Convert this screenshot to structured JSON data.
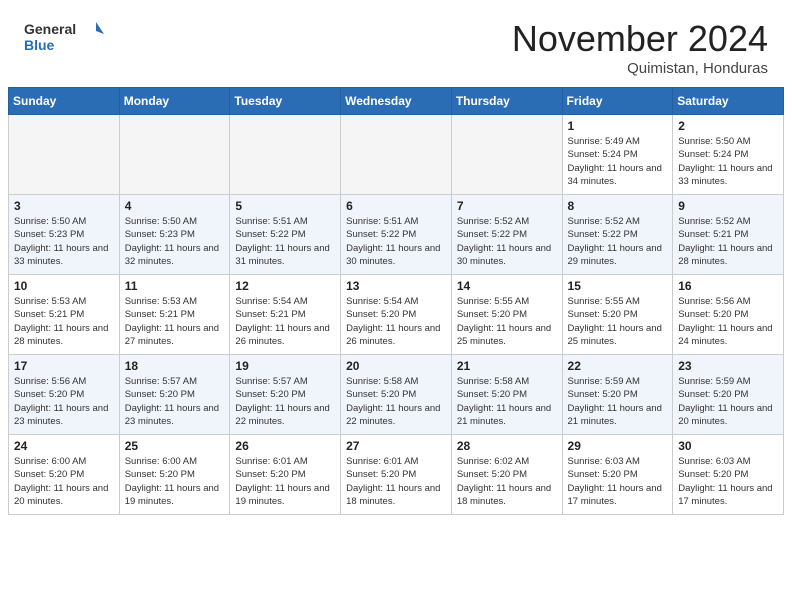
{
  "header": {
    "logo_general": "General",
    "logo_blue": "Blue",
    "month_title": "November 2024",
    "location": "Quimistan, Honduras"
  },
  "weekdays": [
    "Sunday",
    "Monday",
    "Tuesday",
    "Wednesday",
    "Thursday",
    "Friday",
    "Saturday"
  ],
  "weeks": [
    [
      {
        "day": "",
        "info": ""
      },
      {
        "day": "",
        "info": ""
      },
      {
        "day": "",
        "info": ""
      },
      {
        "day": "",
        "info": ""
      },
      {
        "day": "",
        "info": ""
      },
      {
        "day": "1",
        "info": "Sunrise: 5:49 AM\nSunset: 5:24 PM\nDaylight: 11 hours\nand 34 minutes."
      },
      {
        "day": "2",
        "info": "Sunrise: 5:50 AM\nSunset: 5:24 PM\nDaylight: 11 hours\nand 33 minutes."
      }
    ],
    [
      {
        "day": "3",
        "info": "Sunrise: 5:50 AM\nSunset: 5:23 PM\nDaylight: 11 hours\nand 33 minutes."
      },
      {
        "day": "4",
        "info": "Sunrise: 5:50 AM\nSunset: 5:23 PM\nDaylight: 11 hours\nand 32 minutes."
      },
      {
        "day": "5",
        "info": "Sunrise: 5:51 AM\nSunset: 5:22 PM\nDaylight: 11 hours\nand 31 minutes."
      },
      {
        "day": "6",
        "info": "Sunrise: 5:51 AM\nSunset: 5:22 PM\nDaylight: 11 hours\nand 30 minutes."
      },
      {
        "day": "7",
        "info": "Sunrise: 5:52 AM\nSunset: 5:22 PM\nDaylight: 11 hours\nand 30 minutes."
      },
      {
        "day": "8",
        "info": "Sunrise: 5:52 AM\nSunset: 5:22 PM\nDaylight: 11 hours\nand 29 minutes."
      },
      {
        "day": "9",
        "info": "Sunrise: 5:52 AM\nSunset: 5:21 PM\nDaylight: 11 hours\nand 28 minutes."
      }
    ],
    [
      {
        "day": "10",
        "info": "Sunrise: 5:53 AM\nSunset: 5:21 PM\nDaylight: 11 hours\nand 28 minutes."
      },
      {
        "day": "11",
        "info": "Sunrise: 5:53 AM\nSunset: 5:21 PM\nDaylight: 11 hours\nand 27 minutes."
      },
      {
        "day": "12",
        "info": "Sunrise: 5:54 AM\nSunset: 5:21 PM\nDaylight: 11 hours\nand 26 minutes."
      },
      {
        "day": "13",
        "info": "Sunrise: 5:54 AM\nSunset: 5:20 PM\nDaylight: 11 hours\nand 26 minutes."
      },
      {
        "day": "14",
        "info": "Sunrise: 5:55 AM\nSunset: 5:20 PM\nDaylight: 11 hours\nand 25 minutes."
      },
      {
        "day": "15",
        "info": "Sunrise: 5:55 AM\nSunset: 5:20 PM\nDaylight: 11 hours\nand 25 minutes."
      },
      {
        "day": "16",
        "info": "Sunrise: 5:56 AM\nSunset: 5:20 PM\nDaylight: 11 hours\nand 24 minutes."
      }
    ],
    [
      {
        "day": "17",
        "info": "Sunrise: 5:56 AM\nSunset: 5:20 PM\nDaylight: 11 hours\nand 23 minutes."
      },
      {
        "day": "18",
        "info": "Sunrise: 5:57 AM\nSunset: 5:20 PM\nDaylight: 11 hours\nand 23 minutes."
      },
      {
        "day": "19",
        "info": "Sunrise: 5:57 AM\nSunset: 5:20 PM\nDaylight: 11 hours\nand 22 minutes."
      },
      {
        "day": "20",
        "info": "Sunrise: 5:58 AM\nSunset: 5:20 PM\nDaylight: 11 hours\nand 22 minutes."
      },
      {
        "day": "21",
        "info": "Sunrise: 5:58 AM\nSunset: 5:20 PM\nDaylight: 11 hours\nand 21 minutes."
      },
      {
        "day": "22",
        "info": "Sunrise: 5:59 AM\nSunset: 5:20 PM\nDaylight: 11 hours\nand 21 minutes."
      },
      {
        "day": "23",
        "info": "Sunrise: 5:59 AM\nSunset: 5:20 PM\nDaylight: 11 hours\nand 20 minutes."
      }
    ],
    [
      {
        "day": "24",
        "info": "Sunrise: 6:00 AM\nSunset: 5:20 PM\nDaylight: 11 hours\nand 20 minutes."
      },
      {
        "day": "25",
        "info": "Sunrise: 6:00 AM\nSunset: 5:20 PM\nDaylight: 11 hours\nand 19 minutes."
      },
      {
        "day": "26",
        "info": "Sunrise: 6:01 AM\nSunset: 5:20 PM\nDaylight: 11 hours\nand 19 minutes."
      },
      {
        "day": "27",
        "info": "Sunrise: 6:01 AM\nSunset: 5:20 PM\nDaylight: 11 hours\nand 18 minutes."
      },
      {
        "day": "28",
        "info": "Sunrise: 6:02 AM\nSunset: 5:20 PM\nDaylight: 11 hours\nand 18 minutes."
      },
      {
        "day": "29",
        "info": "Sunrise: 6:03 AM\nSunset: 5:20 PM\nDaylight: 11 hours\nand 17 minutes."
      },
      {
        "day": "30",
        "info": "Sunrise: 6:03 AM\nSunset: 5:20 PM\nDaylight: 11 hours\nand 17 minutes."
      }
    ]
  ]
}
